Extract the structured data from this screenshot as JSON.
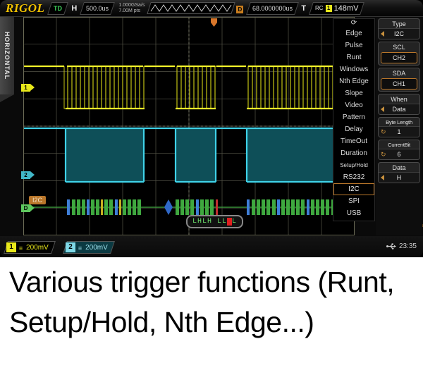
{
  "brand": "RIGOL",
  "topbar": {
    "trigger_status": "TD",
    "h_label": "H",
    "timebase": "500.0us",
    "sample_rate": "1.000GSa/s",
    "mem_depth": "7.00M pts",
    "delay_label": "D",
    "delay_value": "68.0000000us",
    "t_label": "T",
    "trig_coupling": "RC",
    "trig_source": "1",
    "trig_level": "148mV"
  },
  "horizontal_tag": "HORIZONTAL",
  "pointers": {
    "ch1": "1",
    "ch2": "2",
    "decode": "D"
  },
  "decode": {
    "bus_label": "I2C",
    "pattern_prefix": "LHLH LL",
    "pattern_highlight": "H",
    "pattern_suffix": "L"
  },
  "trigger_menu": {
    "knob_icon": "rotary-knob-icon",
    "selected": "I2C",
    "items": [
      "Edge",
      "Pulse",
      "Runt",
      "Windows",
      "Nth Edge",
      "Slope",
      "Video",
      "Pattern",
      "Delay",
      "TimeOut",
      "Duration",
      "Setup/Hold",
      "RS232",
      "I2C",
      "SPI",
      "USB"
    ]
  },
  "panel": [
    {
      "title": "Type",
      "value": "I2C",
      "style": "arrow"
    },
    {
      "title": "SCL",
      "value": "CH2",
      "style": "boxed"
    },
    {
      "title": "SDA",
      "value": "CH1",
      "style": "boxed"
    },
    {
      "title": "When",
      "value": "Data",
      "style": "arrow"
    },
    {
      "title": "Byte Length",
      "value": "1",
      "style": "knob"
    },
    {
      "title": "CurrentBit",
      "value": "6",
      "style": "knob"
    },
    {
      "title": "Data",
      "value": "H",
      "style": "arrow"
    }
  ],
  "bottombar": {
    "ch1": {
      "num": "1",
      "coupling": "≡",
      "volts": "200mV"
    },
    "ch2": {
      "num": "2",
      "coupling": "≡",
      "volts": "200mV"
    },
    "usb_icon": "usb-icon",
    "time": "23:35"
  },
  "caption": "Various trigger functions (Runt, Setup/Hold, Nth Edge...)",
  "colors": {
    "ch1": "#e8e81a",
    "ch2": "#41b7c8",
    "decode_green": "#3fa83f",
    "decode_blue": "#3f7fd8",
    "accent_orange": "#b9762a",
    "brand_yellow": "#f2c200"
  }
}
